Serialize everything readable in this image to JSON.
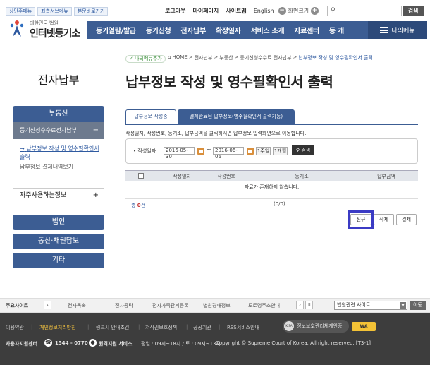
{
  "util": {
    "links": [
      "상단주메뉴",
      "좌측서브메뉴",
      "본문바로가기"
    ],
    "logout": "로그아웃",
    "mypage": "마이페이지",
    "sitemap": "사이트맵",
    "english": "English",
    "zoom_label": "화면크기",
    "zoom_out": "−",
    "zoom_in": "+",
    "search_placeholder": "",
    "search_button": "검색"
  },
  "logo": {
    "sub": "대한민국 법원",
    "name": "인터넷등기소"
  },
  "nav": {
    "items": [
      "등기열람/발급",
      "등기신청",
      "전자납부",
      "확정일자",
      "서비스 소개",
      "자료센터",
      "등 개"
    ],
    "mymenu": "나의메뉴"
  },
  "breadcrumb": {
    "mymenu_add": "나의메뉴추가",
    "home": "HOME",
    "items": [
      "전자납부",
      "부동산",
      "등기신청수수료 전자납부"
    ],
    "current": "납부정보 작성 및 영수필확인서 출력"
  },
  "page_title": "납부정보 작성 및 영수필확인서 출력",
  "sidebar": {
    "title": "전자납부",
    "category": "부동산",
    "sub": "등기신청수수료전자납부",
    "sub_toggle": "−",
    "links": [
      "납부정보 작성 및 영수필확인서 출력",
      "납부정보 결제내역보기"
    ],
    "faq": "자주사용하는정보",
    "faq_toggle": "+",
    "buttons": [
      "법인",
      "동산·채권담보",
      "기타"
    ]
  },
  "tabs": {
    "active": "납부정보 작성중",
    "other": "결제완료된 납부정보(영수필확인서 출력가능)"
  },
  "notice": "작성일자, 작성번호, 등기소, 납부금액을 클릭하시면 납부정보 입력화면으로 이동합니다.",
  "filter": {
    "label": "작성일자",
    "bullet": "•",
    "from": "2016-05-30",
    "to": "2016-06-06",
    "tilde": "~",
    "week": "1주일",
    "month": "1개월",
    "search": "검색"
  },
  "table": {
    "headers": [
      "작성일자",
      "작성번호",
      "등기소",
      "납부금액"
    ],
    "empty": "자료가 존재하지 않습니다.",
    "count_prefix": "총",
    "count_num": "0",
    "count_suffix": "건",
    "paging": "(0/0)"
  },
  "actions": {
    "new": "신규",
    "delete": "삭제",
    "pay": "결제"
  },
  "related": {
    "title": "주요사이트",
    "prev": "‹",
    "next": "›",
    "pause": "॥",
    "items": [
      "전자독촉",
      "전자공탁",
      "전자가족관계등록",
      "법원경매정보",
      "도로명주소안내"
    ],
    "select": "법원관련 사이트",
    "go": "이동"
  },
  "footer": {
    "links": [
      "이용약관",
      "개인정보처리방침",
      "링크시 안내조건",
      "저작권보호정책",
      "공공기관",
      "RSS서비스안내"
    ],
    "kisa_mark": "KISA",
    "kisa": "정보보호관리체계인증",
    "wac": "WA",
    "center": "사용자지원센터",
    "phone": "1544 - 0770",
    "remote": "원격지원 서비스",
    "hours": "평일 : 09시~18시 / 토 : 09시~13시",
    "copyright": "Copyright © Supreme Court of Korea. All right reserved. [T3-1]"
  },
  "colors": {
    "nav": "#3c5d93",
    "sidebar_sub": "#6d7a8e",
    "highlight": "#3b3bc4"
  }
}
